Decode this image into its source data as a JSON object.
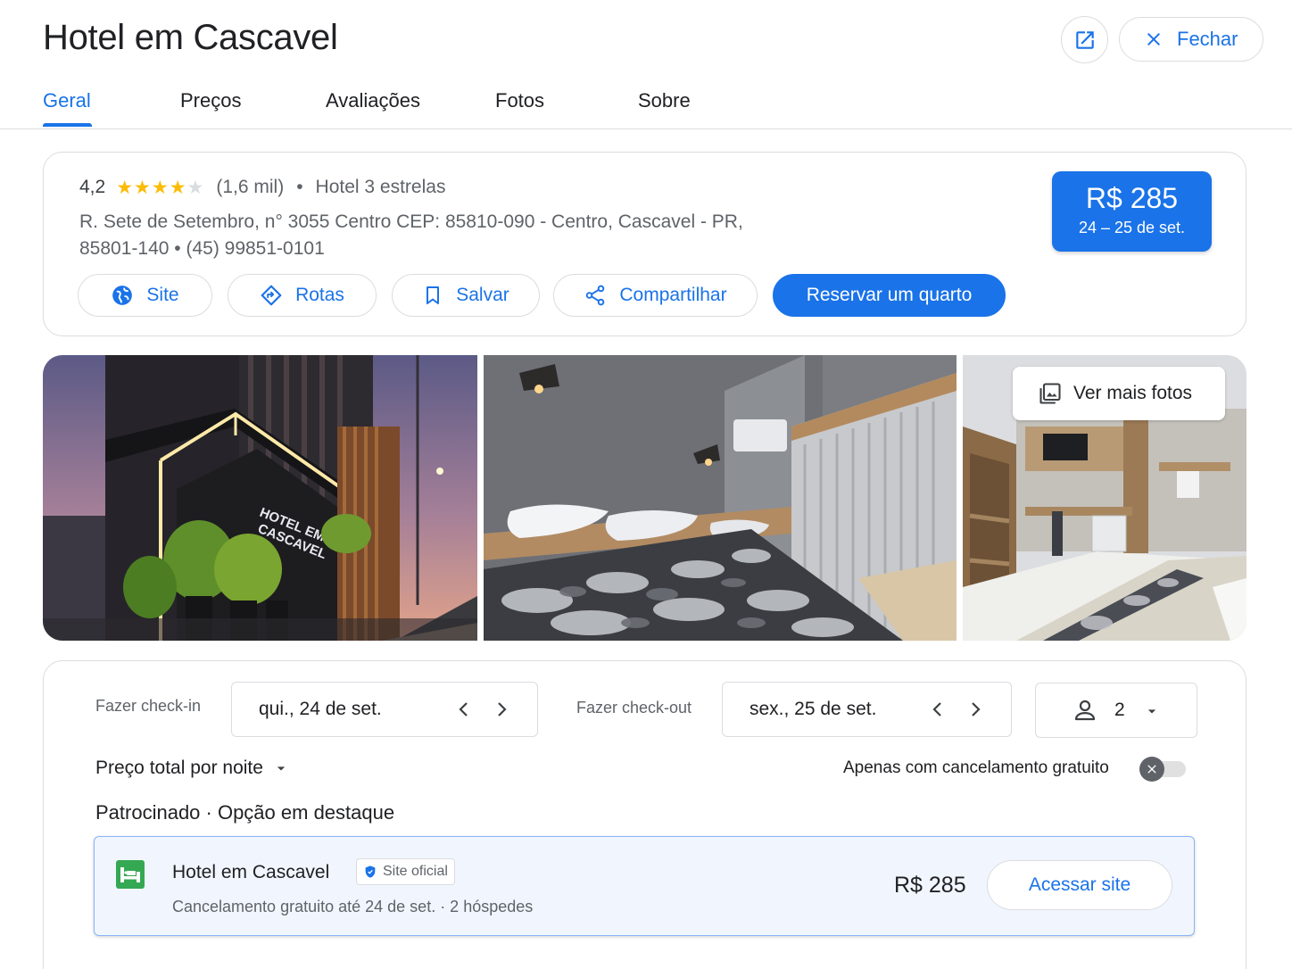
{
  "header": {
    "title": "Hotel em Cascavel",
    "close_label": "Fechar",
    "open_new_icon": "open-in-new-icon",
    "close_icon": "close-icon"
  },
  "tabs": [
    {
      "label": "Geral",
      "active": true
    },
    {
      "label": "Preços",
      "active": false
    },
    {
      "label": "Avaliações",
      "active": false
    },
    {
      "label": "Fotos",
      "active": false
    },
    {
      "label": "Sobre",
      "active": false
    }
  ],
  "overview": {
    "rating": "4,2",
    "stars_filled": 4,
    "stars_total": 5,
    "review_count": "(1,6 mil)",
    "category": "Hotel 3 estrelas",
    "address_line1": "R. Sete de Setembro, n° 3055 Centro CEP: 85810-090 - Centro, Cascavel - PR,",
    "address_line2": "85801-140",
    "phone": "(45) 99851-0101",
    "price": "R$ 285",
    "price_dates": "24 – 25 de set."
  },
  "actions": {
    "site": "Site",
    "directions": "Rotas",
    "save": "Salvar",
    "share": "Compartilhar",
    "book": "Reservar um quarto"
  },
  "photos": {
    "more_label": "Ver mais fotos",
    "sign_line1": "HOTEL EM",
    "sign_line2": "CASCAVEL"
  },
  "booking": {
    "checkin_label": "Fazer check-in",
    "checkin_value": "qui., 24 de set.",
    "checkout_label": "Fazer check-out",
    "checkout_value": "sex., 25 de set.",
    "guests": "2",
    "price_type": "Preço total por noite",
    "free_cancel_label": "Apenas com cancelamento gratuito",
    "free_cancel_on": false,
    "sponsored_title": "Patrocinado · Opção em destaque"
  },
  "offer": {
    "name": "Hotel em Cascavel",
    "badge": "Site oficial",
    "subtitle": "Cancelamento gratuito até 24 de set. · 2 hóspedes",
    "price": "R$ 285",
    "button": "Acessar site"
  },
  "colors": {
    "accent": "#1a73e8",
    "star": "#fbbc04",
    "offer_logo": "#34a853"
  }
}
